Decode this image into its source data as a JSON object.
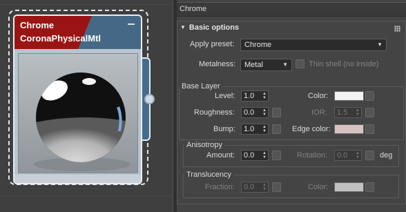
{
  "node": {
    "title_line1": "Chrome",
    "title_line2": "CoronaPhysicalMtl",
    "preview_icon": "chrome-sphere-preview",
    "colors": {
      "header_red": "#9b1414",
      "header_blue": "#446886"
    }
  },
  "panel": {
    "title": "Chrome",
    "rollout": {
      "title": "Basic options",
      "icon": "triangle-down-icon"
    },
    "apply_preset": {
      "label": "Apply preset:",
      "value": "Chrome"
    },
    "metalness": {
      "label": "Metalness:",
      "value": "Metal"
    },
    "thin_shell": {
      "label": "Thin shell (no inside)"
    },
    "base_layer": {
      "title": "Base Layer",
      "level": {
        "label": "Level:",
        "value": "1.0"
      },
      "color": {
        "label": "Color:",
        "swatch": "#f2f2f2"
      },
      "roughness": {
        "label": "Roughness:",
        "value": "0.0"
      },
      "ior": {
        "label": "IOR:",
        "value": "1.5"
      },
      "bump": {
        "label": "Bump:",
        "value": "1.0"
      },
      "edge_color": {
        "label": "Edge color:",
        "swatch": "#d7c1c1"
      }
    },
    "anisotropy": {
      "title": "Anisotropy",
      "amount": {
        "label": "Amount:",
        "value": "0.0"
      },
      "rotation": {
        "label": "Rotation:",
        "value": "0.0"
      },
      "unit": "deg"
    },
    "translucency": {
      "title": "Translucency",
      "fraction": {
        "label": "Fraction:",
        "value": "0.0"
      },
      "color": {
        "label": "Color:",
        "swatch": "#c0c0c0"
      }
    }
  }
}
